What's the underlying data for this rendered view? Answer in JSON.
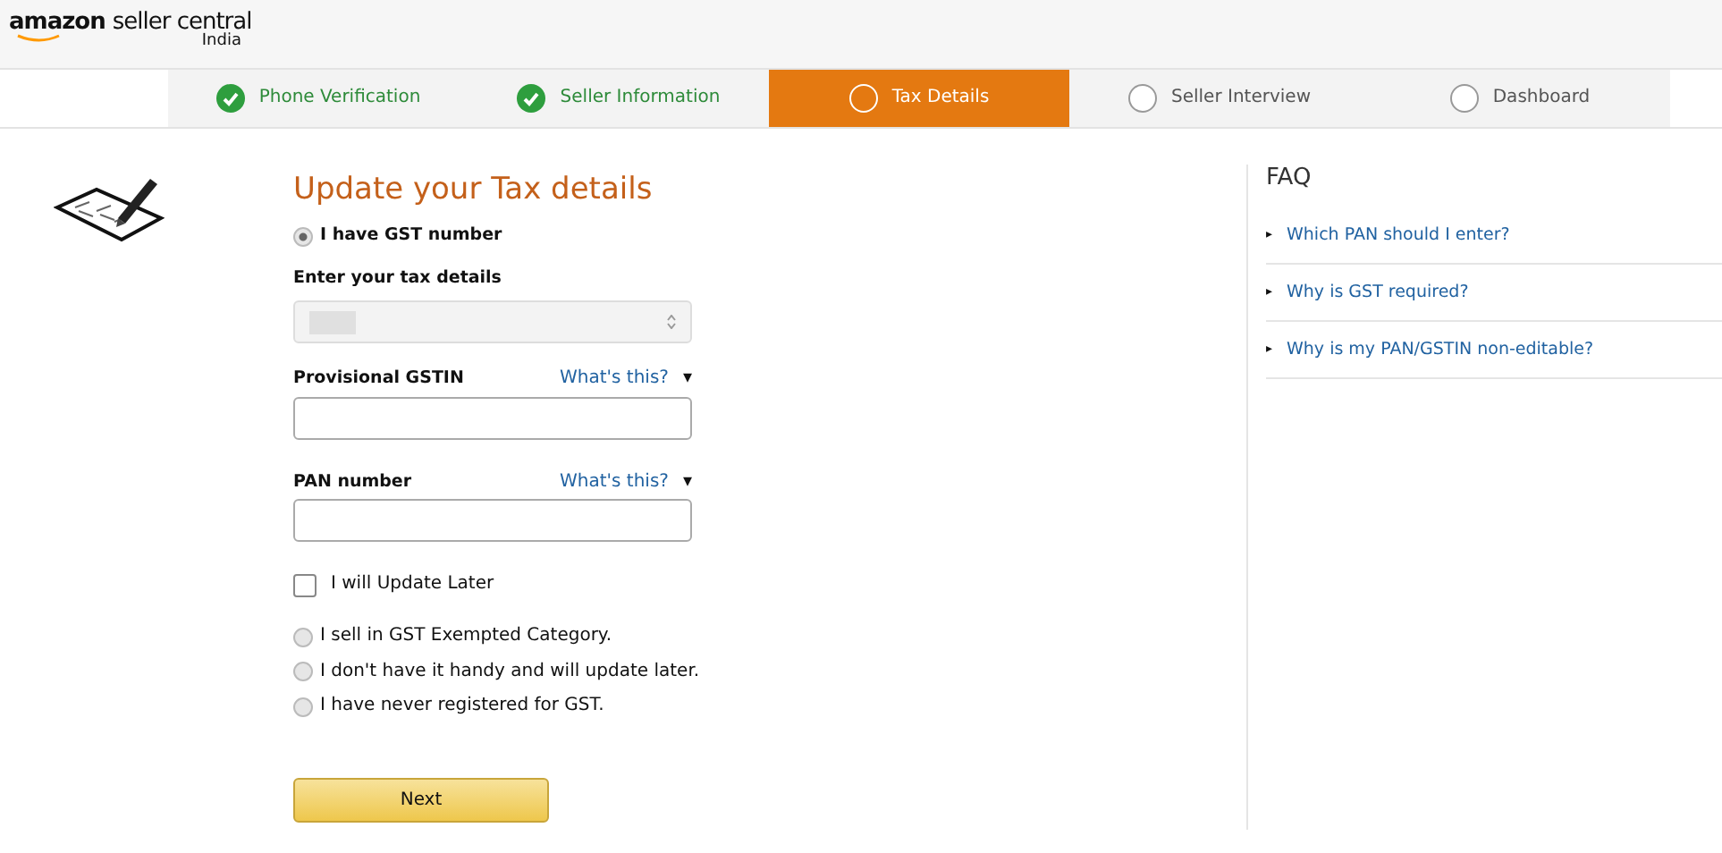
{
  "header": {
    "logo": "amazon",
    "product": "seller central",
    "region": "India"
  },
  "steps": [
    {
      "label": "Phone Verification",
      "completed": true,
      "selected": false
    },
    {
      "label": "Seller Information",
      "completed": true,
      "selected": false
    },
    {
      "label": "Tax Details",
      "completed": false,
      "selected": true
    },
    {
      "label": "Seller Interview",
      "completed": false,
      "selected": false
    },
    {
      "label": "Dashboard",
      "completed": false,
      "selected": false
    }
  ],
  "form": {
    "title": "Update your Tax details",
    "gst_option": {
      "label": "I have GST number",
      "selected": true
    },
    "tax_details_label": "Enter your tax details",
    "tax_select": {
      "disabled": true,
      "redacted": true
    },
    "fields": [
      {
        "label": "Provisional GSTIN",
        "help": "What's this?",
        "help_caret": "▾"
      },
      {
        "label": "PAN number",
        "help": "What's this?",
        "help_caret": "▾"
      }
    ],
    "update_later": {
      "label": "I will Update Later",
      "checked": false
    },
    "reasons": [
      {
        "label": "I sell in GST Exempted Category.",
        "selected": false
      },
      {
        "label": "I don't have it handy and will update later.",
        "selected": false
      },
      {
        "label": "I have never registered for GST.",
        "selected": false
      }
    ],
    "next_button": "Next"
  },
  "faq": {
    "title": "FAQ",
    "items": [
      {
        "bullet": "▸",
        "question": "Which PAN should I enter?"
      },
      {
        "bullet": "▸",
        "question": "Why is GST required?"
      },
      {
        "bullet": "▸",
        "question": "Why is my PAN/GSTIN non-editable?"
      }
    ]
  }
}
